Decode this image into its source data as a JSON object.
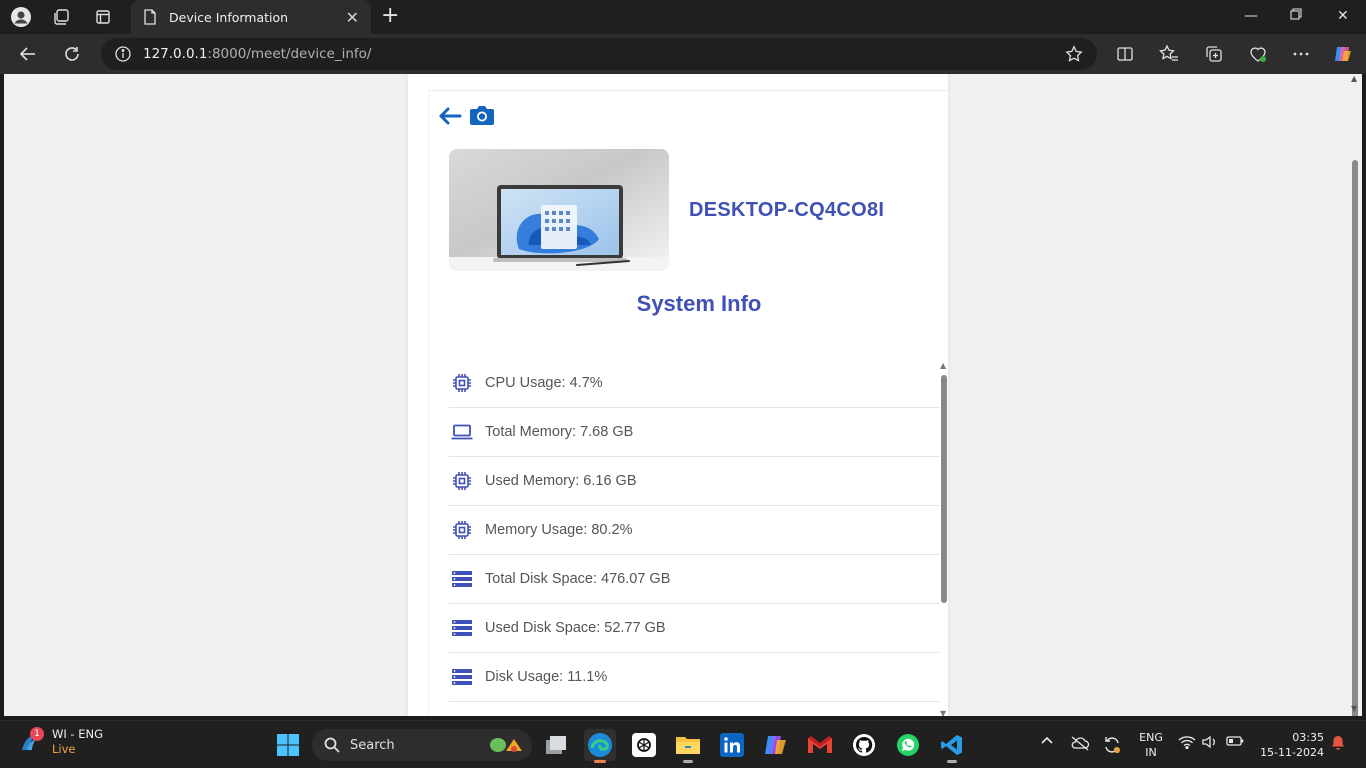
{
  "browser": {
    "tab_title": "Device Information",
    "url_host": "127.0.0.1",
    "url_rest": ":8000/meet/device_info/"
  },
  "page": {
    "device_name": "DESKTOP-CQ4CO8I",
    "section_title": "System Info",
    "info_items": [
      {
        "label": "CPU Usage: 4.7%",
        "icon": "chip-icon"
      },
      {
        "label": "Total Memory: 7.68 GB",
        "icon": "laptop-icon"
      },
      {
        "label": "Used Memory: 6.16 GB",
        "icon": "chip-icon"
      },
      {
        "label": "Memory Usage: 80.2%",
        "icon": "chip-icon"
      },
      {
        "label": "Total Disk Space: 476.07 GB",
        "icon": "server-icon"
      },
      {
        "label": "Used Disk Space: 52.77 GB",
        "icon": "server-icon"
      },
      {
        "label": "Disk Usage: 11.1%",
        "icon": "server-icon"
      }
    ],
    "accent_color": "#3f51b5",
    "back_color": "#1565c0"
  },
  "taskbar": {
    "weather_title": "WI - ENG",
    "weather_sub": "Live",
    "weather_badge": "1",
    "search_label": "Search",
    "lang_1": "ENG",
    "lang_2": "IN",
    "time": "03:35",
    "date": "15-11-2024"
  }
}
